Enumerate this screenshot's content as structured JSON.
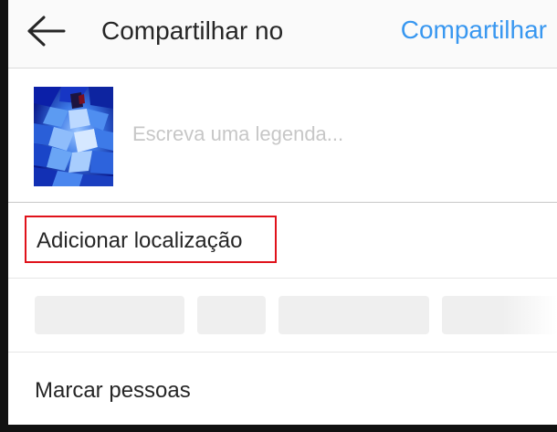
{
  "header": {
    "back_icon": "arrow-left-icon",
    "title": "Compartilhar no",
    "share_label": "Compartilhar",
    "accent_color": "#3897f0"
  },
  "caption": {
    "thumbnail_icon": "photo-thumbnail",
    "placeholder": "Escreva uma legenda..."
  },
  "location": {
    "label": "Adicionar localização",
    "highlight_color": "#e0121b"
  },
  "suggestions": {
    "chip_count_visible": 4
  },
  "tag_people": {
    "label": "Marcar pessoas"
  }
}
